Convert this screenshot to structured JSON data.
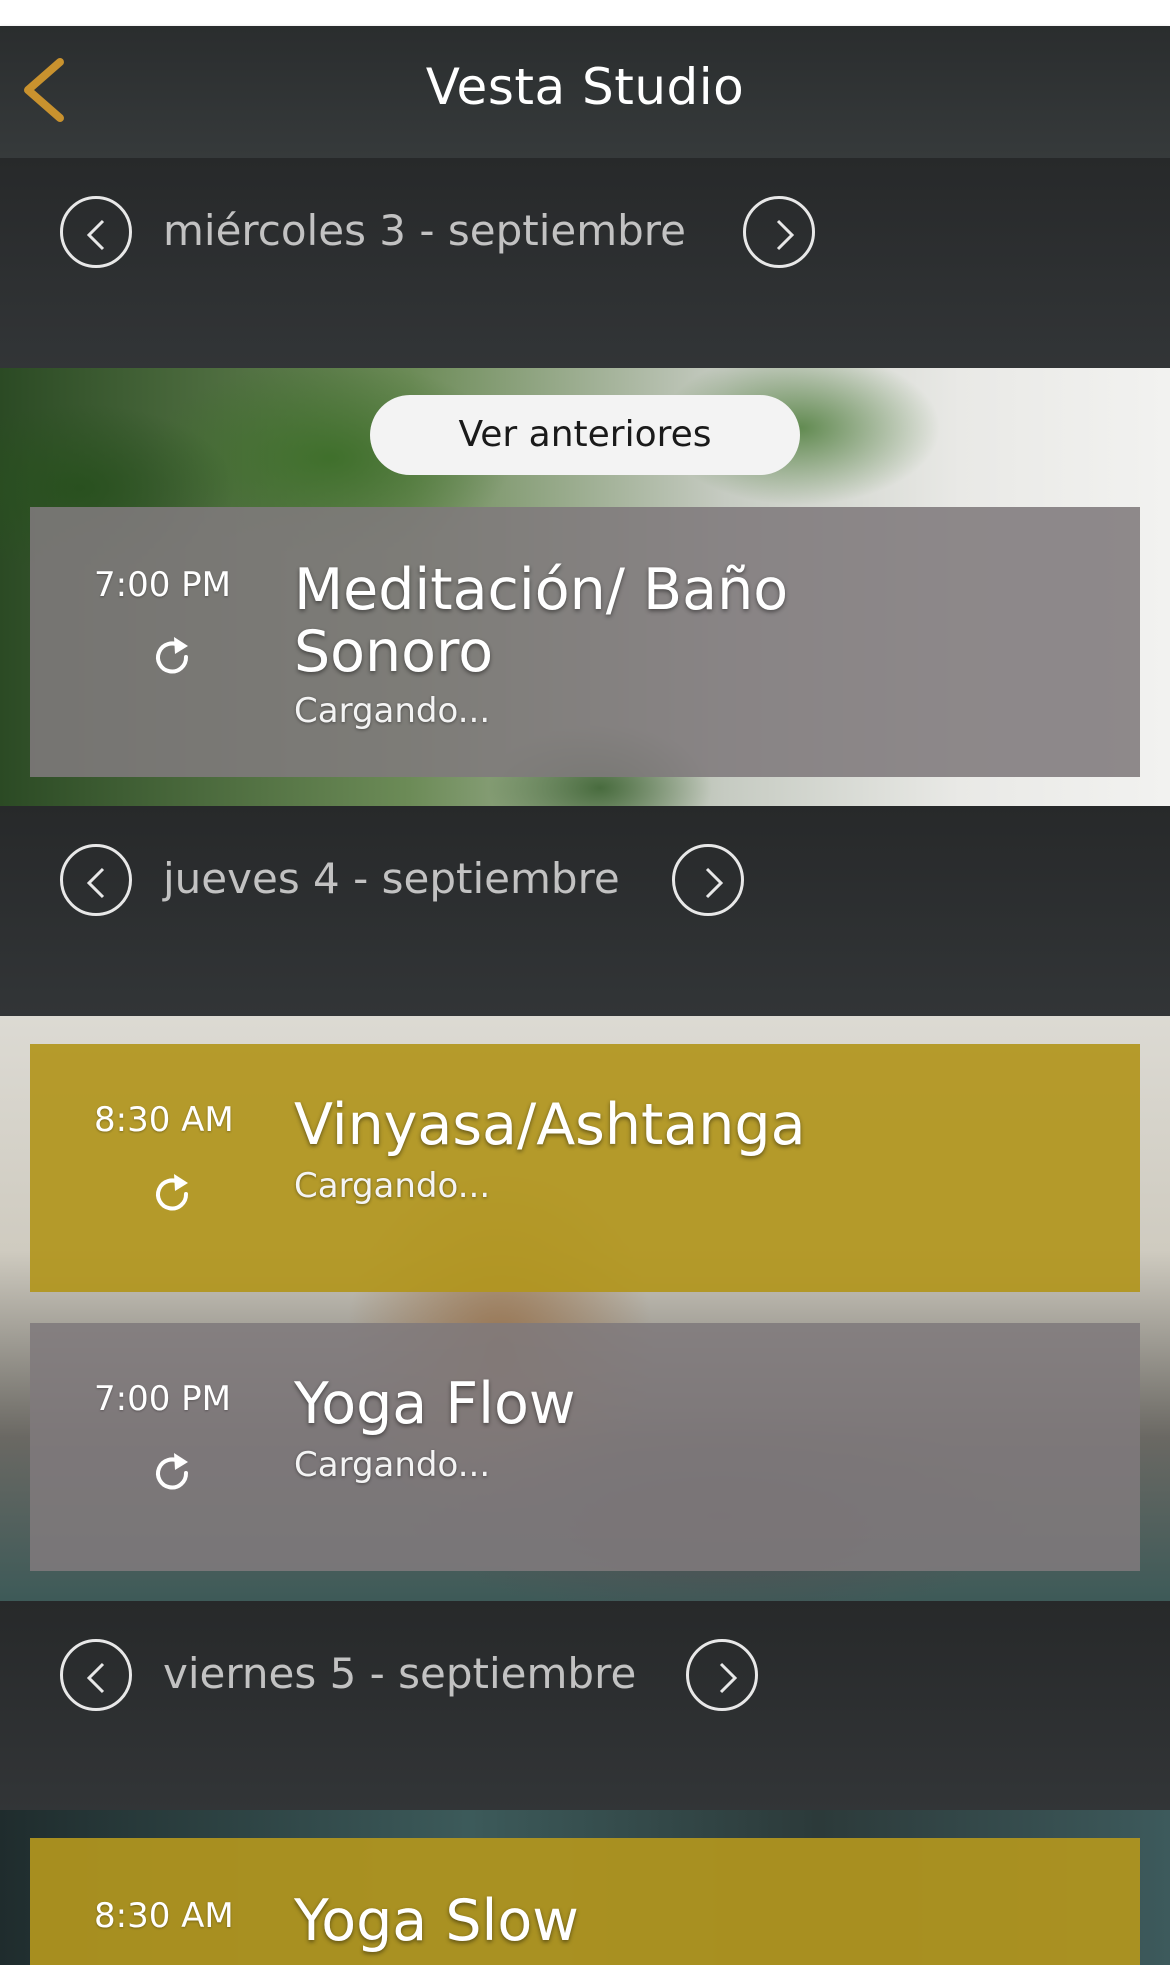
{
  "app": {
    "title": "Vesta Studio"
  },
  "colors": {
    "accent": "#c9922e",
    "card_yellow": "#b2961e",
    "card_gray": "#807a7c",
    "header_dark": "#2a2d2e"
  },
  "actions": {
    "load_previous_label": "Ver anteriores"
  },
  "days": [
    {
      "date_label": "miércoles 3 - septiembre",
      "classes": [
        {
          "time": "7:00 PM",
          "name": "Meditación/ Baño Sonoro",
          "status": "Cargando...",
          "style": "gray"
        }
      ]
    },
    {
      "date_label": "jueves 4 - septiembre",
      "classes": [
        {
          "time": "8:30 AM",
          "name": "Vinyasa/Ashtanga",
          "status": "Cargando...",
          "style": "yellow"
        },
        {
          "time": "7:00 PM",
          "name": "Yoga Flow",
          "status": "Cargando...",
          "style": "gray"
        }
      ]
    },
    {
      "date_label": "viernes 5 - septiembre",
      "classes": [
        {
          "time": "8:30 AM",
          "name": "Yoga Slow",
          "status": "",
          "style": "yellow"
        }
      ]
    }
  ],
  "icons": {
    "back": "chevron-left-icon",
    "prev": "chevron-left-circle-icon",
    "next": "chevron-right-circle-icon",
    "refresh": "refresh-icon"
  }
}
